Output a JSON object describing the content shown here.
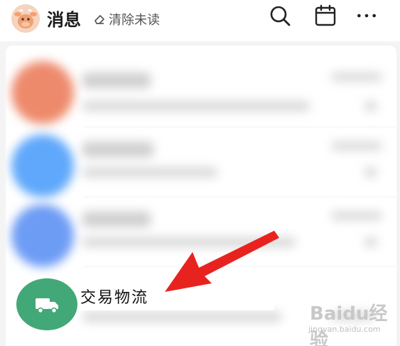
{
  "header": {
    "title": "消息",
    "clear_unread_label": "清除未读",
    "icons": [
      "search-icon",
      "calendar-icon",
      "more-icon"
    ]
  },
  "avatar_icon": "cow-mascot-icon",
  "messages": [
    {
      "avatar_color": "#ee8a6c",
      "blurred": true
    },
    {
      "avatar_color": "#5fa8fb",
      "blurred": true
    },
    {
      "avatar_color": "#6d9cf5",
      "blurred": true
    }
  ],
  "highlighted_item": {
    "label": "交易物流",
    "icon": "truck-icon",
    "icon_bg": "#43a878"
  },
  "annotation": {
    "arrow_color": "#e8231f"
  },
  "watermark": {
    "brand": "Baidu经验",
    "url": "jingyan.baidu.com"
  }
}
